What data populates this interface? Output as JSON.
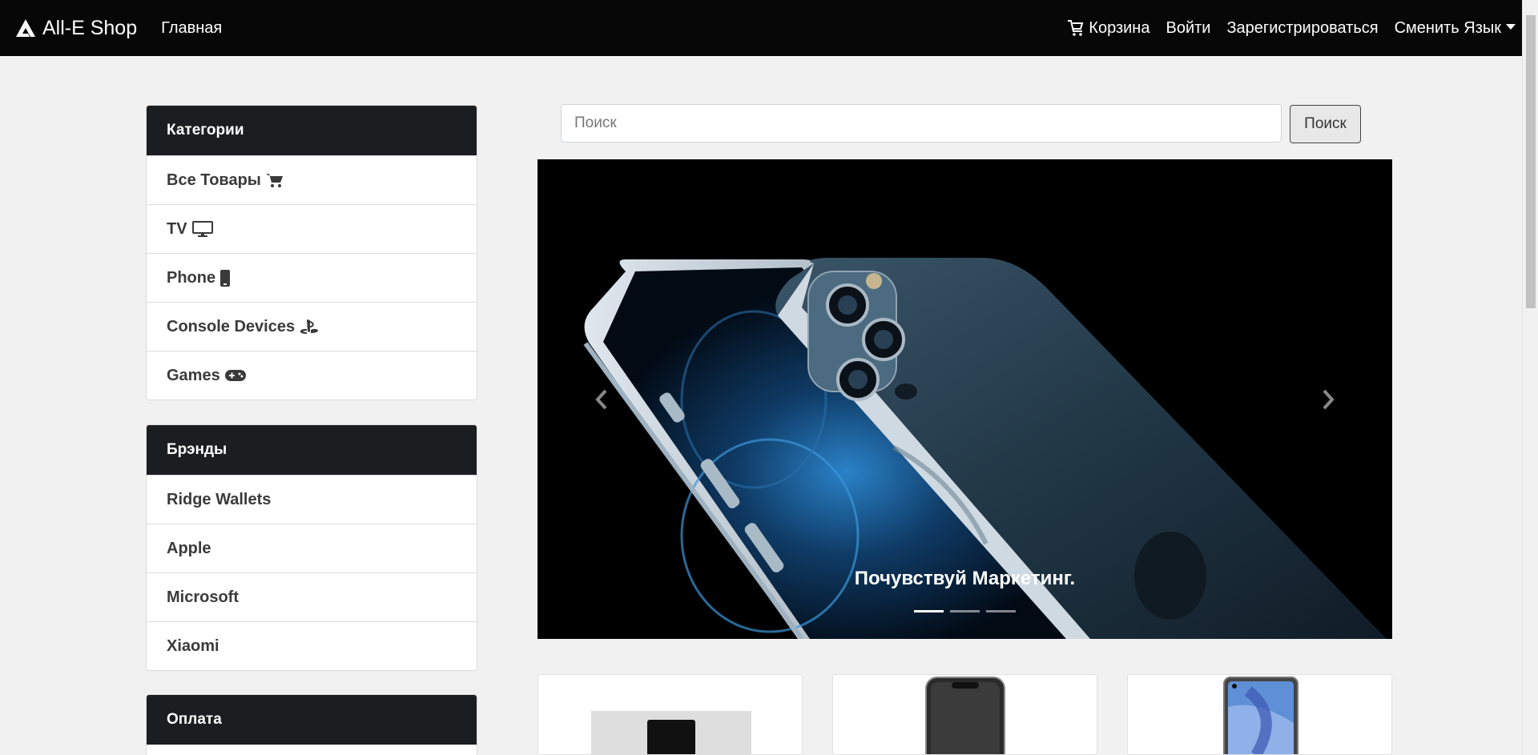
{
  "navbar": {
    "brand": "All-E Shop",
    "home": "Главная",
    "cart": "Корзина",
    "login": "Войти",
    "register": "Зарегистрироваться",
    "language": "Сменить Язык"
  },
  "sidebar": {
    "categories": {
      "title": "Категории",
      "items": [
        {
          "label": "Все Товары",
          "icon": "shopping-cart-icon"
        },
        {
          "label": "TV",
          "icon": "monitor-icon"
        },
        {
          "label": "Phone",
          "icon": "mobile-phone-icon"
        },
        {
          "label": "Console Devices",
          "icon": "playstation-icon"
        },
        {
          "label": "Games",
          "icon": "gamepad-icon"
        }
      ]
    },
    "brands": {
      "title": "Брэнды",
      "items": [
        "Ridge Wallets",
        "Apple",
        "Microsoft",
        "Xiaomi"
      ]
    },
    "payment": {
      "title": "Оплата"
    }
  },
  "search": {
    "placeholder": "Поиск",
    "button": "Поиск"
  },
  "carousel": {
    "caption": "Почувствуй Маркетинг.",
    "slides_count": 3,
    "active_slide": 1
  },
  "products": [
    {
      "image": "xbox-console"
    },
    {
      "image": "black-smartphone"
    },
    {
      "image": "xiaomi-smartphone"
    }
  ],
  "colors": {
    "navbar_bg": "#070707",
    "card_header_bg": "#1b1e21",
    "page_bg": "#f1f1f1"
  }
}
